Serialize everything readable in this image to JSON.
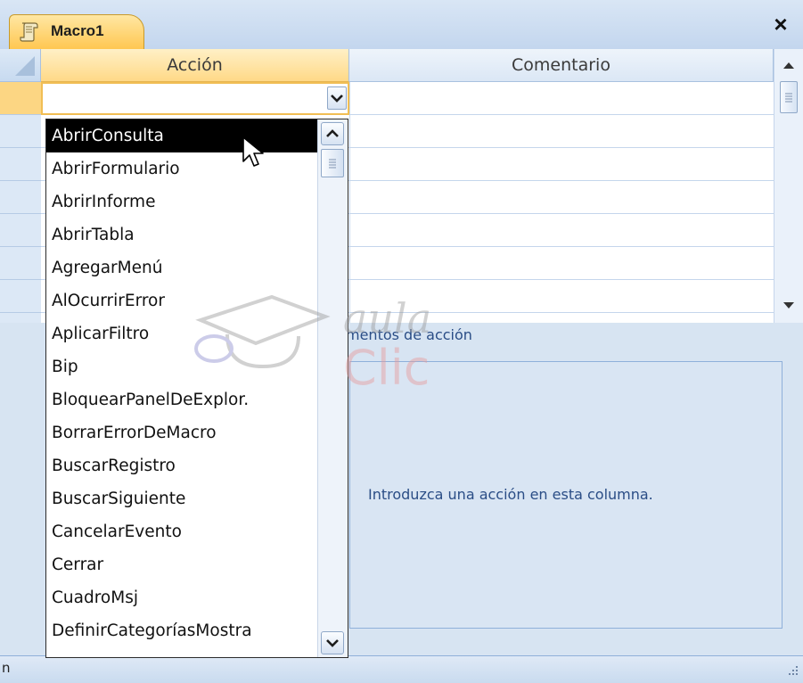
{
  "window": {
    "tab_title": "Macro1",
    "close_glyph": "×"
  },
  "grid": {
    "columns": [
      "Acción",
      "Comentario"
    ]
  },
  "action_list": {
    "items": [
      "AbrirConsulta",
      "AbrirFormulario",
      "AbrirInforme",
      "AbrirTabla",
      "AgregarMenú",
      "AlOcurrirError",
      "AplicarFiltro",
      "Bip",
      "BloquearPanelDeExplor.",
      "BorrarErrorDeMacro",
      "BuscarRegistro",
      "BuscarSiguiente",
      "CancelarEvento",
      "Cerrar",
      "CuadroMsj",
      "DefinirCategoríasMostra"
    ],
    "selected": "AbrirConsulta"
  },
  "arguments": {
    "section_label": "mentos de acción",
    "hint": "Introduzca una acción en esta columna."
  },
  "watermark": {
    "text_top": "aula",
    "text_bottom": "Clic"
  },
  "status": {
    "left_text": "n"
  },
  "colors": {
    "selection_bg": "#000000",
    "active_header": "#ffd987",
    "hint_text": "#2a4d86",
    "watermark": "#e79b9b"
  }
}
